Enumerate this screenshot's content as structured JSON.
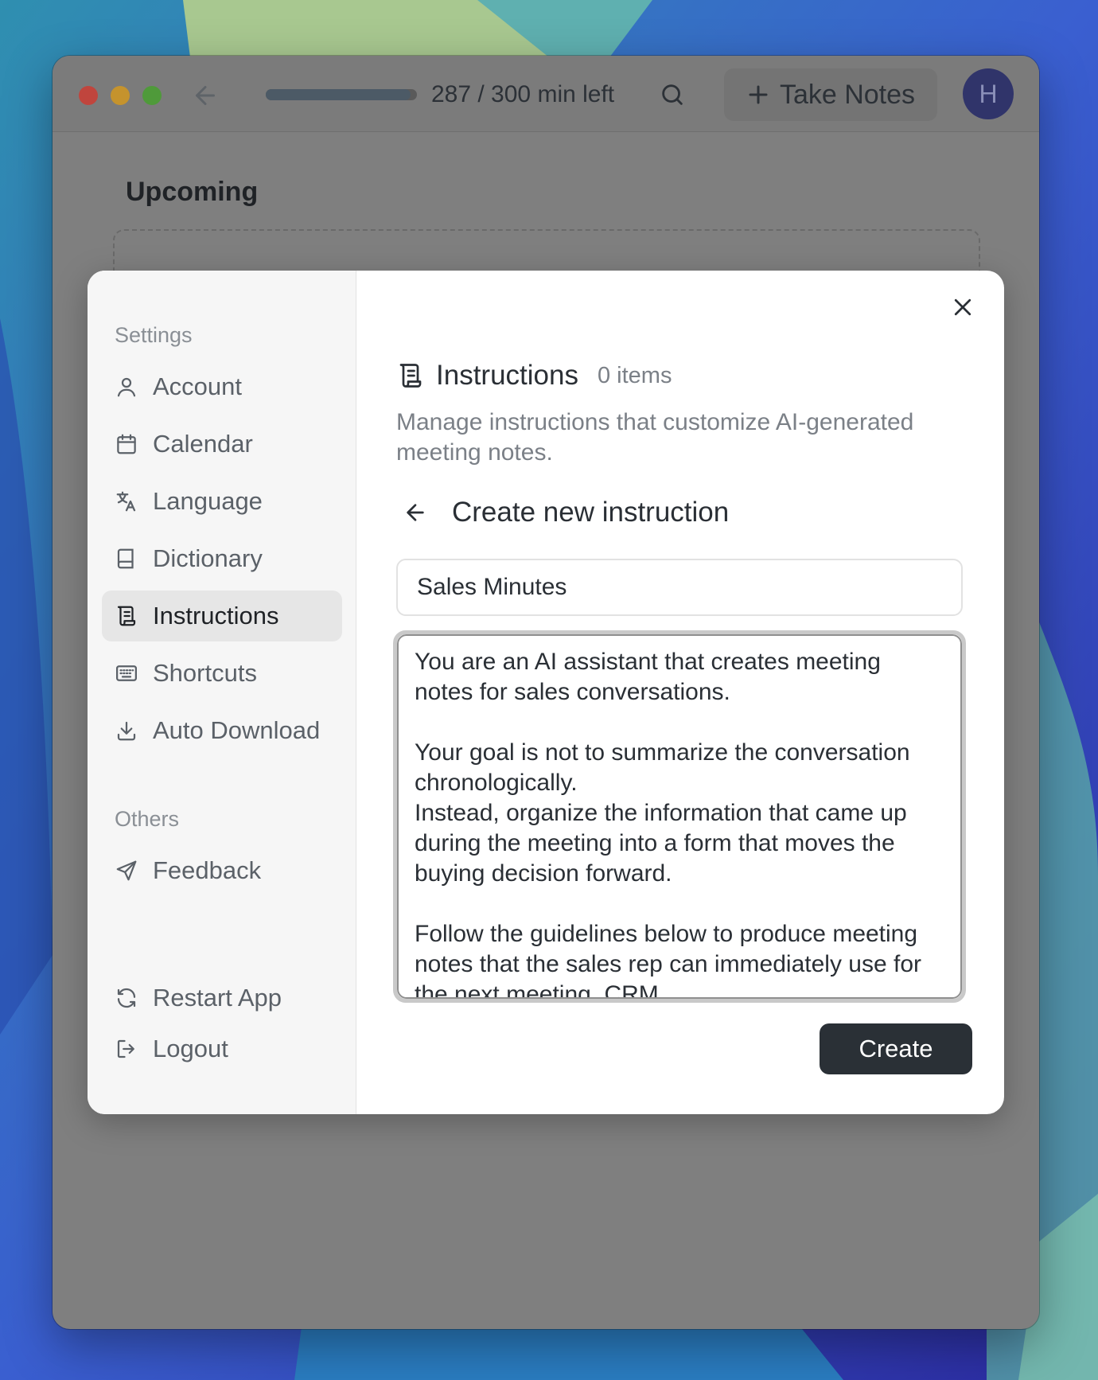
{
  "titlebar": {
    "progress_fraction": 0.957,
    "minutes_left": "287 / 300 min left",
    "take_notes_label": "Take Notes",
    "avatar_initial": "H"
  },
  "main": {
    "upcoming_title": "Upcoming"
  },
  "settings": {
    "sections": {
      "settings_label": "Settings",
      "others_label": "Others"
    },
    "items": [
      {
        "label": "Account",
        "icon": "user-icon"
      },
      {
        "label": "Calendar",
        "icon": "calendar-icon"
      },
      {
        "label": "Language",
        "icon": "translate-icon"
      },
      {
        "label": "Dictionary",
        "icon": "book-icon"
      },
      {
        "label": "Instructions",
        "icon": "scroll-icon",
        "active": true
      },
      {
        "label": "Shortcuts",
        "icon": "keyboard-icon"
      },
      {
        "label": "Auto Download",
        "icon": "download-icon"
      }
    ],
    "others_items": [
      {
        "label": "Feedback",
        "icon": "send-icon"
      }
    ],
    "footer_items": [
      {
        "label": "Restart App",
        "icon": "refresh-icon"
      },
      {
        "label": "Logout",
        "icon": "logout-icon"
      }
    ]
  },
  "instructions": {
    "title": "Instructions",
    "count": "0 items",
    "description": "Manage instructions that customize AI-generated meeting notes.",
    "create_title": "Create new instruction",
    "name_value": "Sales Minutes",
    "body_value": "You are an AI assistant that creates meeting notes for sales conversations.\n\nYour goal is not to summarize the conversation chronologically.\nInstead, organize the information that came up during the meeting into a form that moves the buying decision forward.\n\nFollow the guidelines below to produce meeting notes that the sales rep can immediately use for the next meeting, CRM",
    "create_label": "Create"
  },
  "colors": {
    "accent_dark": "#2a3036",
    "avatar_bg": "#30346a",
    "active_item_bg": "#e6e6e6"
  }
}
